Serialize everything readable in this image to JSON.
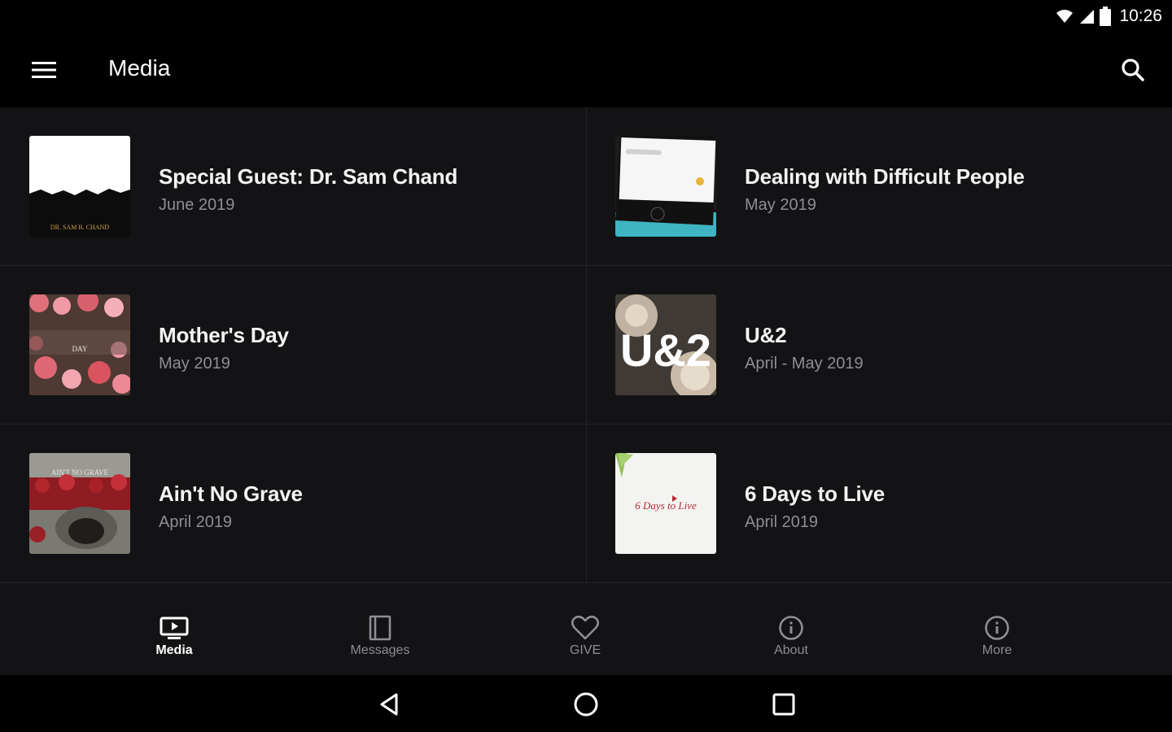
{
  "status_bar": {
    "time": "10:26",
    "icons": [
      "wifi-icon",
      "signal-icon",
      "battery-icon"
    ]
  },
  "app_bar": {
    "title": "Media",
    "menu_icon": "menu-icon",
    "search_icon": "search-icon"
  },
  "media_items": [
    {
      "title": "Special Guest: Dr. Sam Chand",
      "date": "June 2019",
      "thumb_caption": "DR. SAM R. CHAND"
    },
    {
      "title": "Dealing with Difficult People",
      "date": "May 2019"
    },
    {
      "title": "Mother's Day",
      "date": "May 2019",
      "thumb_caption": "DAY"
    },
    {
      "title": "U&2",
      "date": "April - May 2019",
      "thumb_caption": "U&2"
    },
    {
      "title": "Ain't No Grave",
      "date": "April 2019",
      "thumb_caption": "AIN'T NO GRAVE"
    },
    {
      "title": "6 Days to Live",
      "date": "April 2019",
      "thumb_caption": "6 Days to Live"
    }
  ],
  "bottom_nav": [
    {
      "label": "Media",
      "icon": "tv-icon",
      "active": true
    },
    {
      "label": "Messages",
      "icon": "book-icon",
      "active": false
    },
    {
      "label": "GIVE",
      "icon": "heart-icon",
      "active": false
    },
    {
      "label": "About",
      "icon": "info-icon",
      "active": false
    },
    {
      "label": "More",
      "icon": "info-icon",
      "active": false
    }
  ],
  "system_nav": [
    "back-icon",
    "home-icon",
    "recents-icon"
  ],
  "colors": {
    "background": "#000000",
    "surface": "#131315",
    "divider": "#242427",
    "secondary_text": "#8e8e93"
  }
}
